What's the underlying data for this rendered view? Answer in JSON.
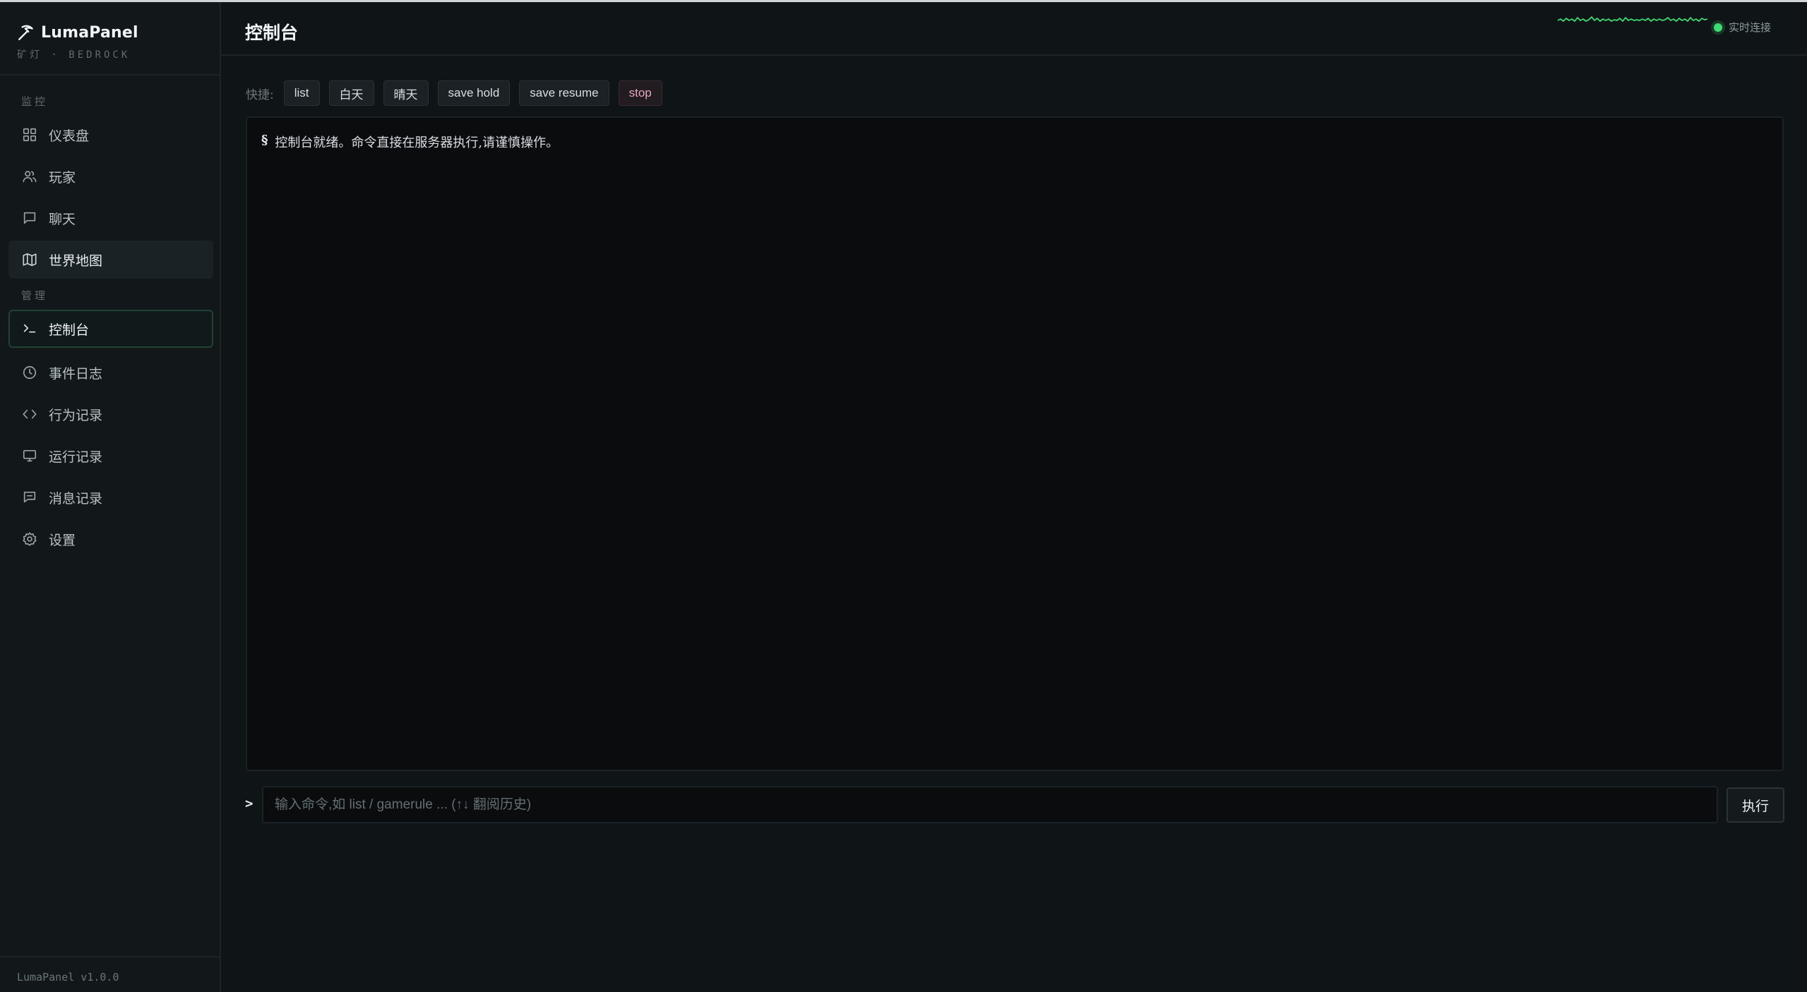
{
  "brand": {
    "name": "LumaPanel",
    "subtitle": "矿灯 · BEDROCK",
    "icon": "pickaxe-icon"
  },
  "sidebar": {
    "groups": [
      {
        "label": "监控"
      },
      {
        "label": "管理"
      }
    ],
    "items": [
      {
        "label": "仪表盘",
        "icon": "dashboard-grid-icon"
      },
      {
        "label": "玩家",
        "icon": "users-icon"
      },
      {
        "label": "聊天",
        "icon": "chat-bubble-icon"
      },
      {
        "label": "世界地图",
        "icon": "map-icon"
      },
      {
        "label": "控制台",
        "icon": "terminal-icon"
      },
      {
        "label": "事件日志",
        "icon": "clock-icon"
      },
      {
        "label": "行为记录",
        "icon": "code-icon"
      },
      {
        "label": "运行记录",
        "icon": "monitor-icon"
      },
      {
        "label": "消息记录",
        "icon": "message-square-icon"
      },
      {
        "label": "设置",
        "icon": "gear-icon"
      }
    ],
    "active_item": "控制台",
    "hover_item": "世界地图",
    "footer_version": "LumaPanel v1.0.0"
  },
  "header": {
    "title": "控制台",
    "status_text": "实时连接",
    "status_color": "#3ddc73"
  },
  "quick": {
    "label": "快捷:",
    "commands": [
      "list",
      "白天",
      "晴天",
      "save hold",
      "save resume",
      "stop"
    ]
  },
  "console": {
    "lines": [
      {
        "prefix": "§",
        "text": "控制台就绪。命令直接在服务器执行,请谨慎操作。"
      }
    ]
  },
  "command": {
    "prompt": ">",
    "placeholder": "输入命令,如 list / gamerule ... (↑↓ 翻阅历史)",
    "value": "",
    "execute_label": "执行"
  },
  "colors": {
    "accent_green": "#3ddc73",
    "danger_text": "#e2a8bc",
    "background": "#0f1416"
  }
}
